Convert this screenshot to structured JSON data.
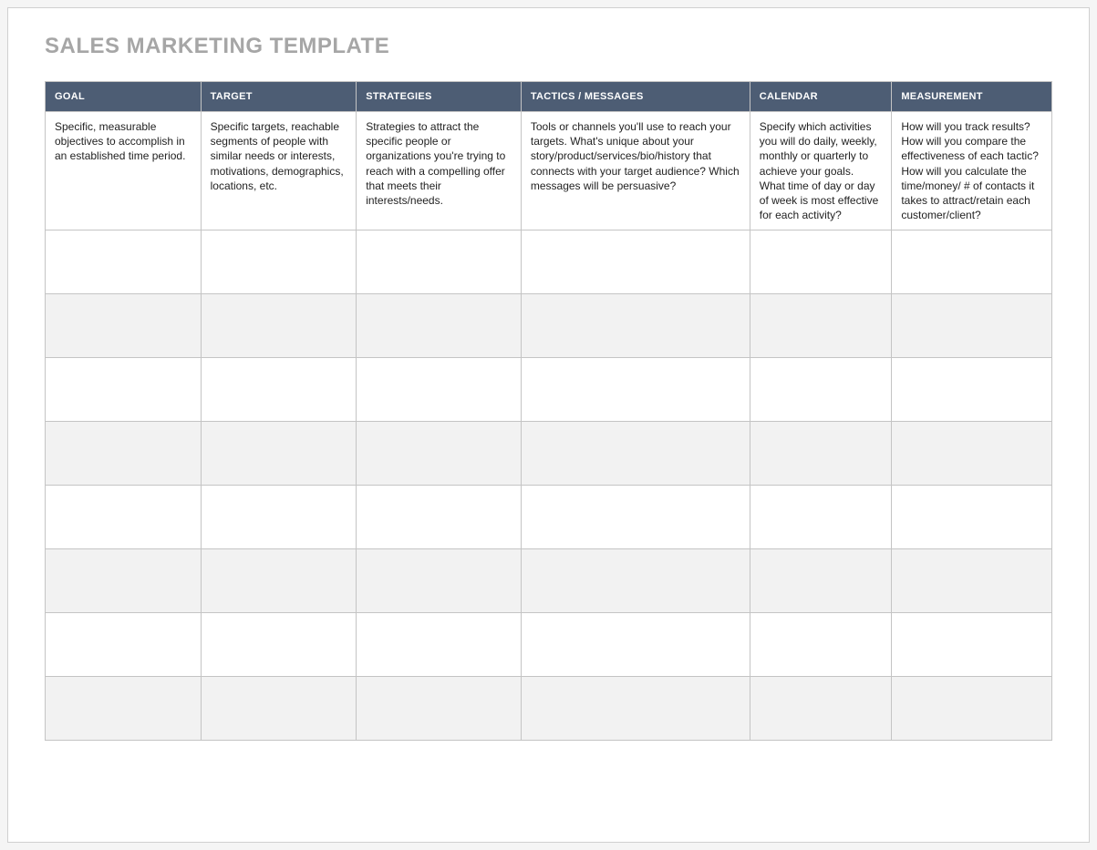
{
  "title": "SALES MARKETING TEMPLATE",
  "columns": [
    {
      "header": "GOAL",
      "description": "Specific, measurable objectives to accomplish in an established time period."
    },
    {
      "header": "TARGET",
      "description": "Specific targets, reachable segments of people with similar needs or interests, motivations, demographics, locations, etc."
    },
    {
      "header": "STRATEGIES",
      "description": "Strategies to attract the specific people or organizations you're trying to reach with a compelling offer that meets their interests/needs."
    },
    {
      "header": "TACTICS / MESSAGES",
      "description": "Tools or channels you'll use to reach your targets. What's unique about your story/product/services/bio/history that connects with your target audience? Which messages will be persuasive?"
    },
    {
      "header": "CALENDAR",
      "description": "Specify which activities you will do daily, weekly, monthly or quarterly to achieve your goals. What time of day or day of week is most effective for each activity?"
    },
    {
      "header": "MEASUREMENT",
      "description": "How will you track results? How will you compare the effectiveness of each tactic? How will you calculate the time/money/ # of contacts it takes to attract/retain each customer/client?"
    }
  ],
  "rows": [
    [
      "",
      "",
      "",
      "",
      "",
      ""
    ],
    [
      "",
      "",
      "",
      "",
      "",
      ""
    ],
    [
      "",
      "",
      "",
      "",
      "",
      ""
    ],
    [
      "",
      "",
      "",
      "",
      "",
      ""
    ],
    [
      "",
      "",
      "",
      "",
      "",
      ""
    ],
    [
      "",
      "",
      "",
      "",
      "",
      ""
    ],
    [
      "",
      "",
      "",
      "",
      "",
      ""
    ],
    [
      "",
      "",
      "",
      "",
      "",
      ""
    ]
  ]
}
